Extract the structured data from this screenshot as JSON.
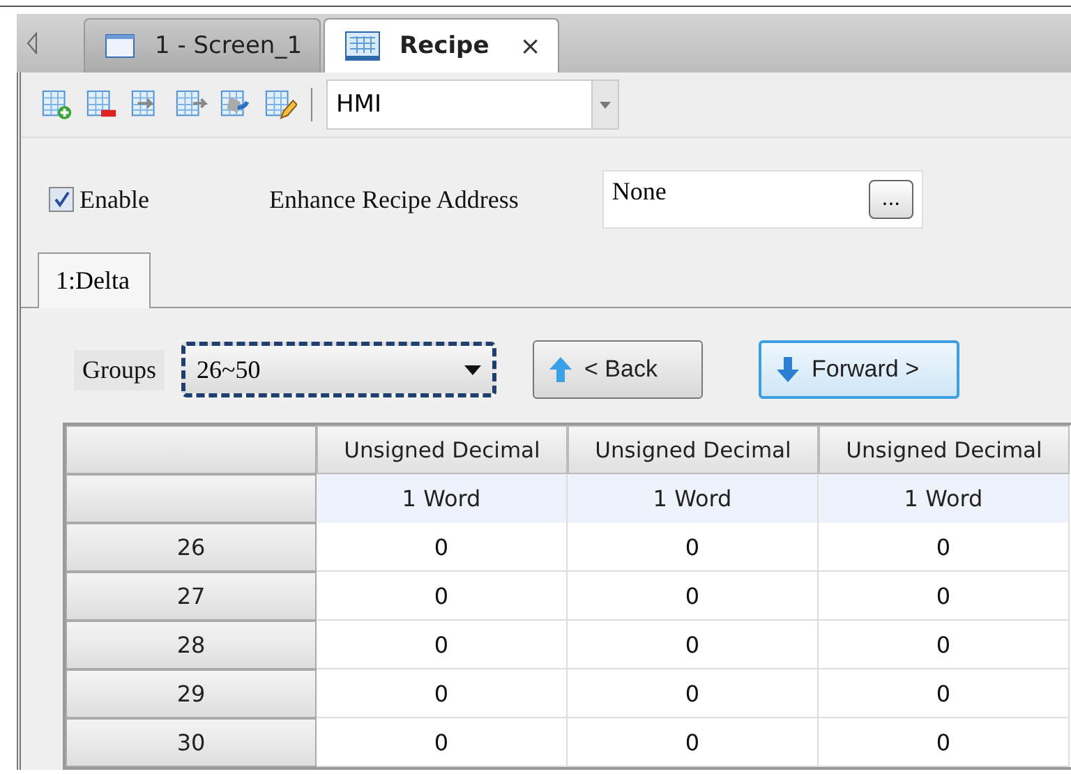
{
  "tabs": [
    {
      "label": "1 - Screen_1",
      "selected": false,
      "kind": "screen"
    },
    {
      "label": "Recipe",
      "selected": true,
      "kind": "recipe",
      "close": "×"
    }
  ],
  "toolbar": {
    "combo": "HMI"
  },
  "enable": {
    "label": "Enable",
    "checked": true
  },
  "address": {
    "label": "Enhance Recipe Address",
    "value": "None",
    "browse": "..."
  },
  "subtabs": [
    {
      "label": "1:Delta",
      "selected": true
    }
  ],
  "groups": {
    "label": "Groups",
    "value": "26~50",
    "focused": true
  },
  "buttons": [
    {
      "label": "< Back",
      "kind": "back",
      "focused": false
    },
    {
      "label": "Forward >",
      "kind": "forward",
      "focused": true
    }
  ],
  "table": {
    "columns": [
      "Unsigned Decimal",
      "Unsigned Decimal",
      "Unsigned Decimal"
    ],
    "units": [
      "1 Word",
      "1 Word",
      "1 Word"
    ],
    "rows": [
      {
        "label": "26",
        "cells": [
          "0",
          "0",
          "0"
        ]
      },
      {
        "label": "27",
        "cells": [
          "0",
          "0",
          "0"
        ]
      },
      {
        "label": "28",
        "cells": [
          "0",
          "0",
          "0"
        ]
      },
      {
        "label": "29",
        "cells": [
          "0",
          "0",
          "0"
        ]
      },
      {
        "label": "30",
        "cells": [
          "0",
          "0",
          "0"
        ]
      }
    ]
  }
}
